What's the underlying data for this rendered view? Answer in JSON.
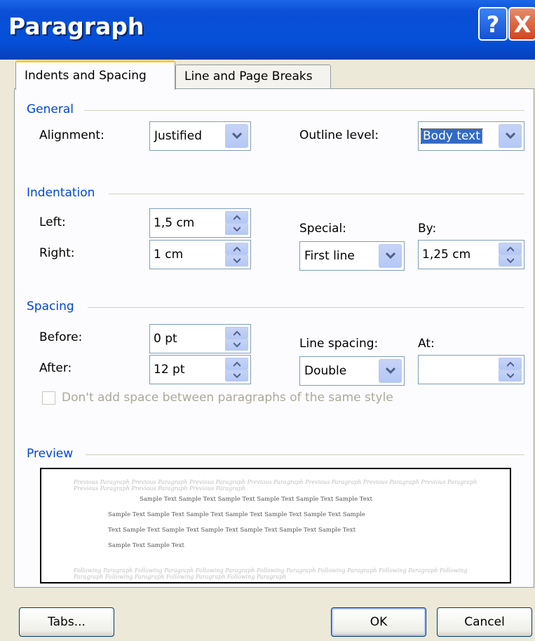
{
  "window": {
    "title": "Paragraph",
    "help_glyph": "?",
    "close_glyph": "X"
  },
  "tabs": [
    {
      "label": "Indents and Spacing",
      "active": true
    },
    {
      "label": "Line and Page Breaks",
      "active": false
    }
  ],
  "general": {
    "heading": "General",
    "alignment_label": "Alignment:",
    "alignment_value": "Justified",
    "outline_label": "Outline level:",
    "outline_value": "Body text"
  },
  "indentation": {
    "heading": "Indentation",
    "left_label": "Left:",
    "left_value": "1,5 cm",
    "right_label": "Right:",
    "right_value": "1 cm",
    "special_label": "Special:",
    "special_value": "First line",
    "by_label": "By:",
    "by_value": "1,25 cm"
  },
  "spacing": {
    "heading": "Spacing",
    "before_label": "Before:",
    "before_value": "0 pt",
    "after_label": "After:",
    "after_value": "12 pt",
    "line_spacing_label": "Line spacing:",
    "line_spacing_value": "Double",
    "at_label": "At:",
    "at_value": "",
    "checkbox_label": "Don't add space between paragraphs of the same style",
    "checkbox_checked": false
  },
  "preview": {
    "heading": "Preview",
    "previous_text": "Previous Paragraph Previous Paragraph Previous Paragraph Previous Paragraph Previous Paragraph Previous Paragraph Previous Paragraph Previous Paragraph Previous Paragraph Previous Paragraph",
    "sample_lines": [
      "Sample Text Sample Text Sample Text Sample Text Sample Text Sample Text",
      "Sample Text Sample Text Sample Text Sample Text Sample Text Sample Text Sample",
      "Text Sample Text Sample Text Sample Text Sample Text Sample Text Sample Text",
      "Sample Text Sample Text"
    ],
    "following_text": "Following Paragraph Following Paragraph Following Paragraph Following Paragraph Following Paragraph Following Paragraph Following Paragraph Following Paragraph Following Paragraph Following Paragraph"
  },
  "buttons": {
    "tabs": "Tabs...",
    "ok": "OK",
    "cancel": "Cancel"
  },
  "colors": {
    "titlebar": "#0550D8",
    "section_heading": "#0046D5",
    "dialog_bg": "#ECE9D8",
    "tab_highlight": "#FFC83C"
  }
}
